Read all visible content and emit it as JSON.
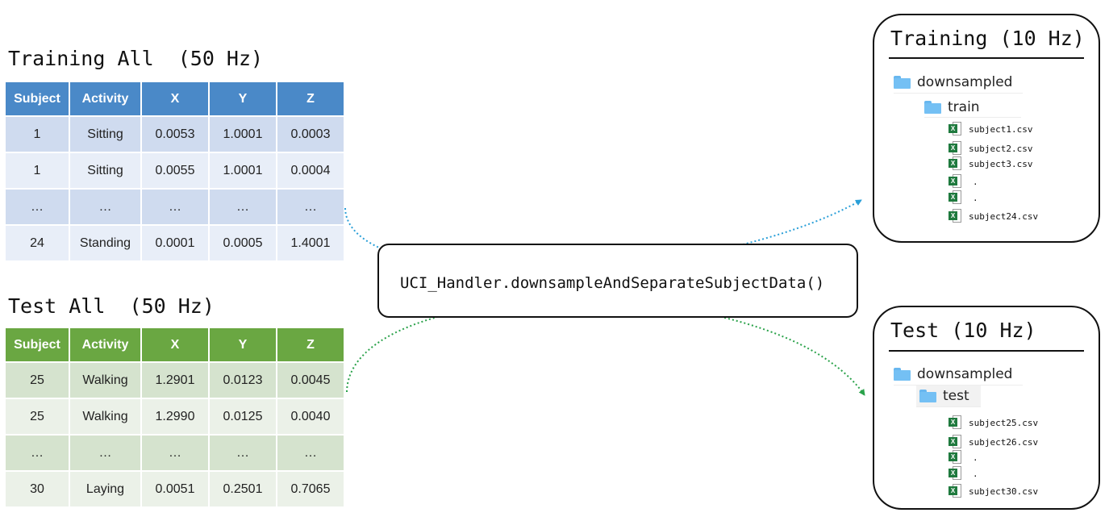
{
  "training_all": {
    "title": "Training All  (50 Hz)",
    "headers": [
      "Subject",
      "Activity",
      "X",
      "Y",
      "Z"
    ],
    "rows": [
      [
        "1",
        "Sitting",
        "0.0053",
        "1.0001",
        "0.0003"
      ],
      [
        "1",
        "Sitting",
        "0.0055",
        "1.0001",
        "0.0004"
      ],
      [
        "…",
        "…",
        "…",
        "…",
        "…"
      ],
      [
        "24",
        "Standing",
        "0.0001",
        "0.0005",
        "1.4001"
      ]
    ],
    "accent": "#4a89c8"
  },
  "test_all": {
    "title": "Test All  (50 Hz)",
    "headers": [
      "Subject",
      "Activity",
      "X",
      "Y",
      "Z"
    ],
    "rows": [
      [
        "25",
        "Walking",
        "1.2901",
        "0.0123",
        "0.0045"
      ],
      [
        "25",
        "Walking",
        "1.2990",
        "0.0125",
        "0.0040"
      ],
      [
        "…",
        "…",
        "…",
        "…",
        "…"
      ],
      [
        "30",
        "Laying",
        "0.0051",
        "0.2501",
        "0.7065"
      ]
    ],
    "accent": "#6aa742"
  },
  "function_box": {
    "label": "UCI_Handler.downsampleAndSeparateSubjectData()"
  },
  "training_panel": {
    "title": "Training (10 Hz)",
    "root_folder": "downsampled",
    "sub_folder": "train",
    "files": [
      "subject1.csv",
      "subject2.csv",
      "subject3.csv",
      ".",
      ".",
      "subject24.csv"
    ]
  },
  "test_panel": {
    "title": "Test (10 Hz)",
    "root_folder": "downsampled",
    "sub_folder": "test",
    "files": [
      "subject25.csv",
      "subject26.csv",
      ".",
      ".",
      "subject30.csv"
    ]
  },
  "icons": {
    "folder": "folder-icon",
    "file": "excel-file-icon",
    "badge_letter": "X"
  },
  "colors": {
    "blue_arrow": "#2a9fd8",
    "green_arrow": "#2aa24a",
    "folder": "#74c0f4",
    "excel": "#1f7a3e"
  }
}
